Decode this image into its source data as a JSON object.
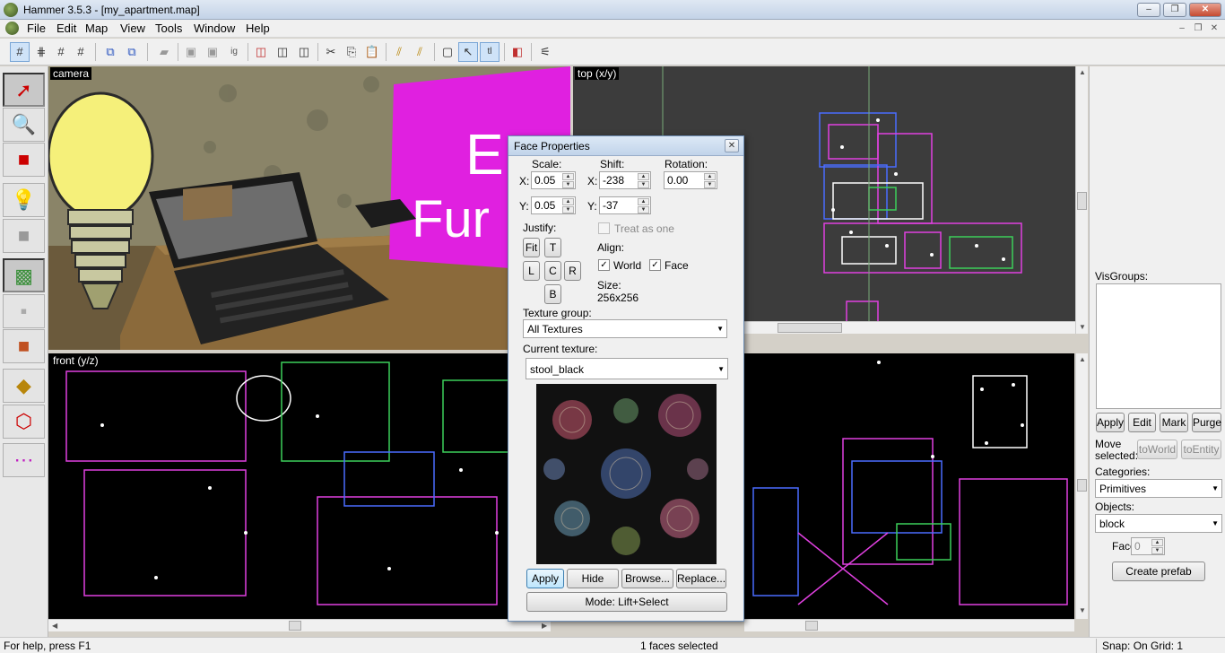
{
  "window": {
    "title": "Hammer 3.5.3 - [my_apartment.map]",
    "minimize": "–",
    "maximize": "❐",
    "close": "✕"
  },
  "menu": [
    "File",
    "Edit",
    "Map",
    "View",
    "Tools",
    "Window",
    "Help"
  ],
  "mdi_controls": [
    "–",
    "❐",
    "✕"
  ],
  "viewports": {
    "camera": "camera",
    "top": "top (x/y)",
    "front": "front (y/z)"
  },
  "camera_scene": {
    "sign_text_1": "E",
    "sign_text_2": "Fur"
  },
  "face_properties": {
    "title": "Face Properties",
    "scale_label": "Scale:",
    "shift_label": "Shift:",
    "rotation_label": "Rotation:",
    "x_label": "X:",
    "y_label": "Y:",
    "scale_x": "0.05",
    "scale_y": "0.05",
    "shift_x": "-238",
    "shift_y": "-37",
    "rotation": "0.00",
    "treat_as_one": "Treat as one",
    "justify_label": "Justify:",
    "justify_fit": "Fit",
    "justify_t": "T",
    "justify_l": "L",
    "justify_c": "C",
    "justify_r": "R",
    "justify_b": "B",
    "align_label": "Align:",
    "align_world": "World",
    "align_face": "Face",
    "world_checked": true,
    "face_checked": true,
    "size_label": "Size:",
    "size_value": "256x256",
    "texture_group_label": "Texture group:",
    "texture_group_value": "All Textures",
    "current_texture_label": "Current texture:",
    "current_texture_value": "stool_black",
    "apply": "Apply",
    "hide_mask": "Hide mask",
    "browse": "Browse...",
    "replace": "Replace...",
    "mode": "Mode: Lift+Select"
  },
  "right_panel": {
    "visgroups_label": "VisGroups:",
    "apply": "Apply",
    "edit": "Edit",
    "mark": "Mark",
    "purge": "Purge",
    "move_selected_1": "Move",
    "move_selected_2": "selected:",
    "to_world": "toWorld",
    "to_entity": "toEntity",
    "categories_label": "Categories:",
    "categories_value": "Primitives",
    "objects_label": "Objects:",
    "objects_value": "block",
    "faces_label": "Faces:",
    "faces_value": "0",
    "create_prefab": "Create prefab"
  },
  "status": {
    "help": "For help, press F1",
    "selection": "1 faces selected",
    "snap": "Snap: On Grid: 1"
  }
}
